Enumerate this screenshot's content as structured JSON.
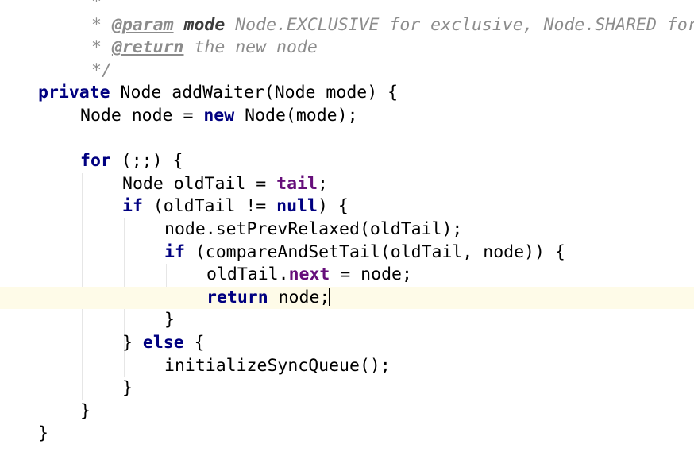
{
  "editor": {
    "language": "java",
    "colors": {
      "background": "#ffffff",
      "current_line": "#fefbe8",
      "keyword": "#000080",
      "field": "#660e7a",
      "comment": "#8c8c8c",
      "text": "#000000"
    },
    "lines": [
      {
        "indent": 1,
        "tokens": [
          {
            "t": "*",
            "k": "comment"
          }
        ]
      },
      {
        "indent": 1,
        "tokens": [
          {
            "t": "* ",
            "k": "comment"
          },
          {
            "t": "@param",
            "k": "doctag"
          },
          {
            "t": " ",
            "k": "comment"
          },
          {
            "t": "mode",
            "k": "param"
          },
          {
            "t": " Node.EXCLUSIVE for exclusive, Node.SHARED for shared",
            "k": "comment"
          }
        ]
      },
      {
        "indent": 1,
        "tokens": [
          {
            "t": "* ",
            "k": "comment"
          },
          {
            "t": "@return",
            "k": "doctag"
          },
          {
            "t": " the new node",
            "k": "comment"
          }
        ]
      },
      {
        "indent": 1,
        "tokens": [
          {
            "t": "*/",
            "k": "comment"
          }
        ]
      },
      {
        "indent": 0,
        "tokens": [
          {
            "t": "private",
            "k": "keyword"
          },
          {
            "t": " Node addWaiter(Node mode) {",
            "k": "plain"
          }
        ]
      },
      {
        "indent": 1,
        "tokens": [
          {
            "t": "Node node = ",
            "k": "plain"
          },
          {
            "t": "new",
            "k": "keyword"
          },
          {
            "t": " Node(mode);",
            "k": "plain"
          }
        ]
      },
      {
        "indent": 0,
        "tokens": []
      },
      {
        "indent": 1,
        "tokens": [
          {
            "t": "for",
            "k": "keyword"
          },
          {
            "t": " (;;) {",
            "k": "plain"
          }
        ]
      },
      {
        "indent": 2,
        "tokens": [
          {
            "t": "Node oldTail = ",
            "k": "plain"
          },
          {
            "t": "tail",
            "k": "field"
          },
          {
            "t": ";",
            "k": "plain"
          }
        ]
      },
      {
        "indent": 2,
        "tokens": [
          {
            "t": "if",
            "k": "keyword"
          },
          {
            "t": " (oldTail != ",
            "k": "plain"
          },
          {
            "t": "null",
            "k": "keyword"
          },
          {
            "t": ") {",
            "k": "plain"
          }
        ]
      },
      {
        "indent": 3,
        "tokens": [
          {
            "t": "node.setPrevRelaxed(oldTail);",
            "k": "plain"
          }
        ]
      },
      {
        "indent": 3,
        "tokens": [
          {
            "t": "if",
            "k": "keyword"
          },
          {
            "t": " (compareAndSetTail(oldTail, node)) {",
            "k": "plain"
          }
        ]
      },
      {
        "indent": 4,
        "tokens": [
          {
            "t": "oldTail.",
            "k": "plain"
          },
          {
            "t": "next",
            "k": "field"
          },
          {
            "t": " = node;",
            "k": "plain"
          }
        ]
      },
      {
        "indent": 4,
        "current": true,
        "tokens": [
          {
            "t": "return",
            "k": "keyword"
          },
          {
            "t": " node;",
            "k": "plain"
          },
          {
            "caret": true
          }
        ]
      },
      {
        "indent": 3,
        "tokens": [
          {
            "t": "}",
            "k": "plain"
          }
        ]
      },
      {
        "indent": 2,
        "tokens": [
          {
            "t": "} ",
            "k": "plain"
          },
          {
            "t": "else",
            "k": "keyword"
          },
          {
            "t": " {",
            "k": "plain"
          }
        ]
      },
      {
        "indent": 3,
        "tokens": [
          {
            "t": "initializeSyncQueue();",
            "k": "plain"
          }
        ]
      },
      {
        "indent": 2,
        "tokens": [
          {
            "t": "}",
            "k": "plain"
          }
        ]
      },
      {
        "indent": 1,
        "tokens": [
          {
            "t": "}",
            "k": "plain"
          }
        ]
      },
      {
        "indent": 0,
        "tokens": [
          {
            "t": "}",
            "k": "plain"
          }
        ]
      }
    ]
  }
}
